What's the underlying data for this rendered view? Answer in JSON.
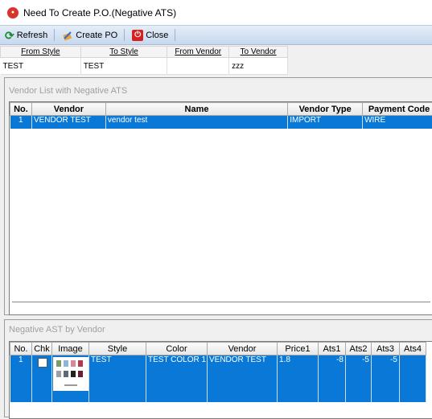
{
  "window": {
    "title": "Need To Create P.O.(Negative ATS)",
    "icon": "app-logo-icon"
  },
  "toolbar": {
    "refresh_label": "Refresh",
    "create_po_label": "Create PO",
    "close_label": "Close"
  },
  "filter": {
    "headers": [
      "From Style",
      "To Style",
      "From Vendor",
      "To Vendor"
    ],
    "values": [
      "TEST",
      "TEST",
      "",
      "zzz"
    ]
  },
  "vendor_panel": {
    "title": "Vendor List with Negative ATS",
    "headers": [
      "No.",
      "Vendor",
      "Name",
      "Vendor Type",
      "Payment Code"
    ],
    "rows": [
      [
        "1",
        "VENDOR TEST",
        "vendor test",
        "IMPORT",
        "WIRE"
      ]
    ]
  },
  "ats_panel": {
    "title": "Negative AST by Vendor",
    "headers": [
      "No.",
      "Chk",
      "Image",
      "Style",
      "Color",
      "Vendor",
      "Price1",
      "Ats1",
      "Ats2",
      "Ats3",
      "Ats4"
    ],
    "rows": [
      [
        "1",
        "",
        "",
        "TEST",
        "TEST COLOR 1",
        "VENDOR TEST",
        "1.8",
        "-8",
        "-5",
        "-5",
        ""
      ]
    ]
  },
  "colors": {
    "selection": "#0a78d7",
    "toolbar": "#c7d9ef"
  }
}
